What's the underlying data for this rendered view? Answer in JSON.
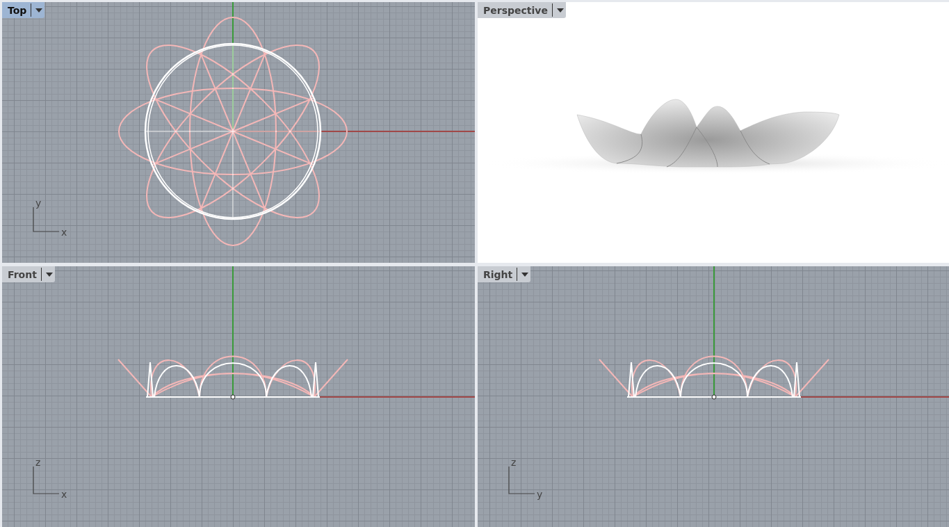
{
  "viewports": [
    {
      "title": "Top",
      "selected": true,
      "kind": "plan",
      "axis_labels": {
        "vertical": "y",
        "horizontal": "x"
      }
    },
    {
      "title": "Perspective",
      "selected": false,
      "kind": "shaded"
    },
    {
      "title": "Front",
      "selected": false,
      "kind": "elevation",
      "axis_labels": {
        "vertical": "z",
        "horizontal": "x"
      }
    },
    {
      "title": "Right",
      "selected": false,
      "kind": "elevation",
      "axis_labels": {
        "vertical": "z",
        "horizontal": "y"
      }
    }
  ]
}
